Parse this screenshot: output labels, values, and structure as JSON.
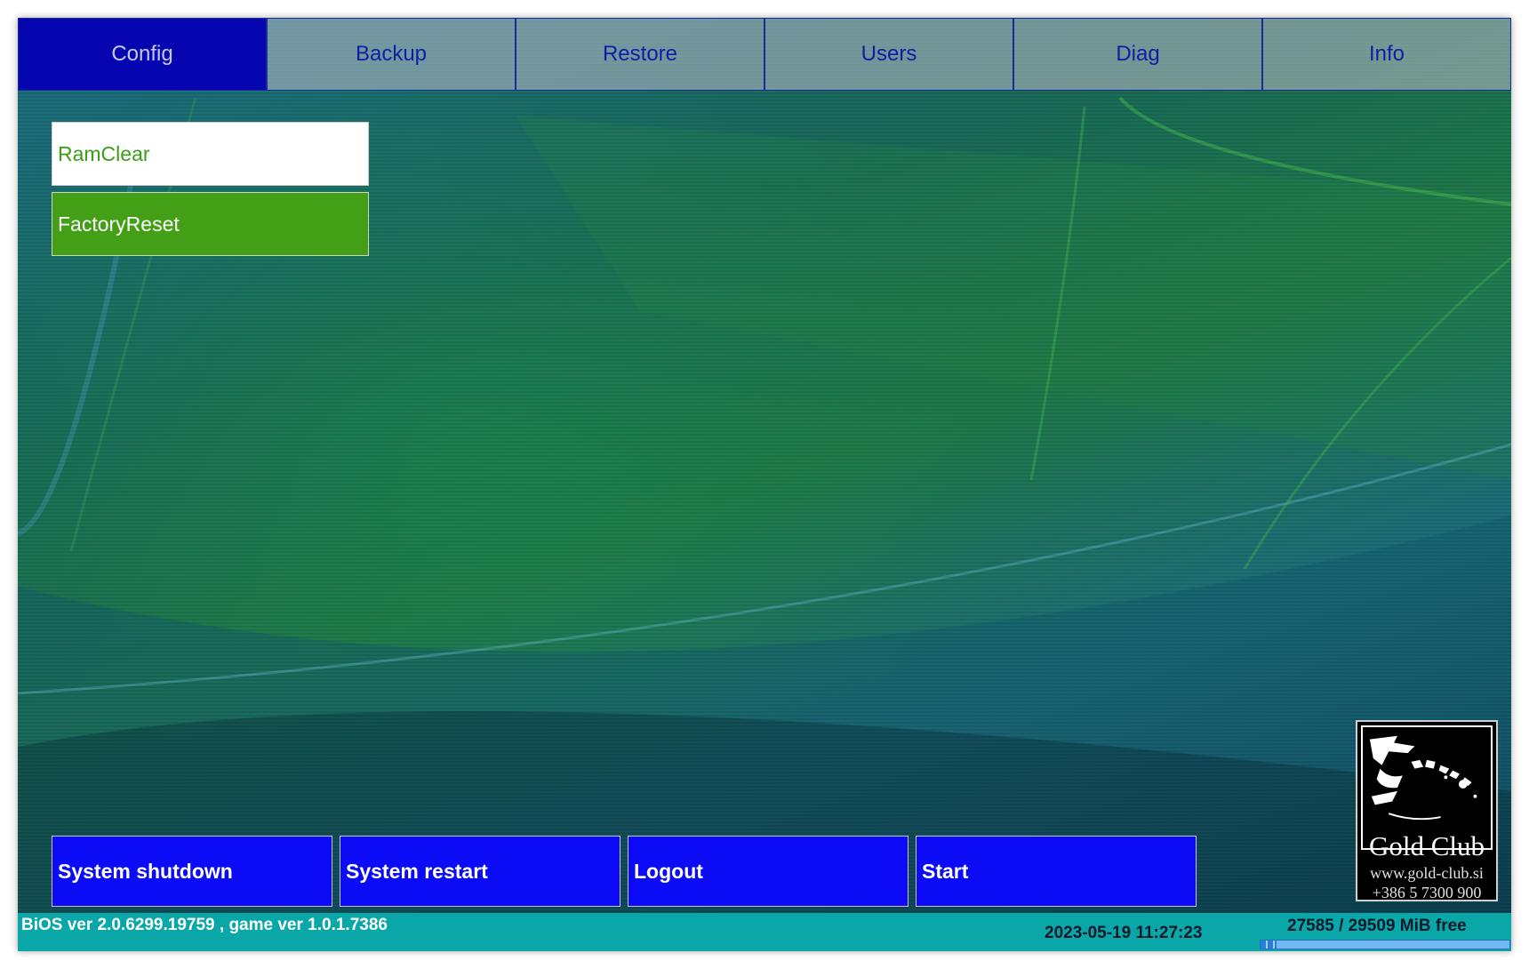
{
  "tabs": [
    {
      "label": "Config",
      "active": true
    },
    {
      "label": "Backup",
      "active": false
    },
    {
      "label": "Restore",
      "active": false
    },
    {
      "label": "Users",
      "active": false
    },
    {
      "label": "Diag",
      "active": false
    },
    {
      "label": "Info",
      "active": false
    }
  ],
  "actions": {
    "ramclear_label": "RamClear",
    "factoryreset_label": "FactoryReset"
  },
  "bottom_buttons": {
    "shutdown_label": "System shutdown",
    "restart_label": "System restart",
    "logout_label": "Logout",
    "start_label": "Start"
  },
  "logo": {
    "name": "Gold Club",
    "website": "www.gold-club.si",
    "phone": "+386 5 7300 900"
  },
  "status": {
    "version_text": "BiOS ver 2.0.6299.19759 , game ver 1.0.1.7386",
    "datetime": "2023-05-19 11:27:23",
    "memory_text": "27585 / 29509 MiB free",
    "memory_used_fraction": 0.065
  },
  "colors": {
    "active_tab": "#0606b0",
    "tab_text": "#0c1fa6",
    "button_blue": "#0b0bf6",
    "button_green": "#43a016",
    "status_bar": "#0aa7a9"
  }
}
